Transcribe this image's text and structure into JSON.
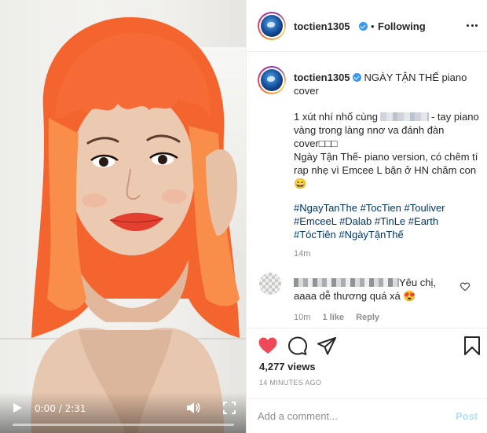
{
  "video": {
    "current_time": "0:00",
    "duration": "2:31",
    "time_display": "0:00 / 2:31",
    "progress_fraction": 0.0,
    "icons": {
      "play": "play-icon",
      "volume": "volume-icon",
      "fullscreen": "fullscreen-icon"
    }
  },
  "header": {
    "username": "toctien1305",
    "separator": "•",
    "follow_status": "Following",
    "more_icon": "more-options-icon"
  },
  "caption": {
    "username": "toctien1305",
    "title": "NGÀY TẬN THẾ piano cover",
    "line1_prefix": "1 xút nhí nhố cùng",
    "line1_suffix": "- tay piano vàng trong làng nnơ va đánh đàn cover□□□",
    "line2": "Ngày Tận Thế- piano version, có chêm tí rap nhẹ vì Emcee L bận ở HN chăm con😄",
    "hashtags": [
      "#NgayTanThe",
      "#TocTien",
      "#Touliver",
      "#EmceeL",
      "#Dalab",
      "#TinLe",
      "#Earth",
      "#TócTiên",
      "#NgàyTậnThế"
    ],
    "time": "14m"
  },
  "comment": {
    "text": "Yêu chị, aaaa dễ thương quá xá 😍",
    "time": "10m",
    "likes": "1 like",
    "reply_label": "Reply"
  },
  "actions": {
    "icons": [
      "heart-icon",
      "comment-icon",
      "share-icon",
      "bookmark-icon"
    ],
    "views": "4,277 views",
    "posted_ago": "14 MINUTES AGO"
  },
  "comment_box": {
    "placeholder": "Add a comment...",
    "post_label": "Post"
  },
  "colors": {
    "liked_heart": "#ed4956",
    "link": "#003569",
    "muted": "#8e8e8e",
    "post_disabled": "#b2dffc",
    "verified": "#3897f0",
    "hair": "#ff6a3d"
  }
}
